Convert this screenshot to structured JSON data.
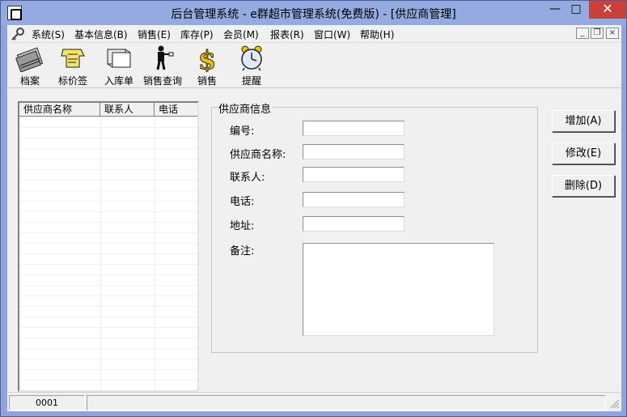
{
  "window": {
    "title": "后台管理系统 - e群超市管理系统(免费版) - [供应商管理]",
    "minimize_glyph": "—",
    "maximize_glyph": "□",
    "close_glyph": "✕",
    "mdi_minimize": "_",
    "mdi_restore": "❐",
    "mdi_close": "×"
  },
  "menu": {
    "items": [
      {
        "label": "系统(S)"
      },
      {
        "label": "基本信息(B)"
      },
      {
        "label": "销售(E)"
      },
      {
        "label": "库存(P)"
      },
      {
        "label": "会员(M)"
      },
      {
        "label": "报表(R)"
      },
      {
        "label": "窗口(W)"
      },
      {
        "label": "帮助(H)"
      }
    ]
  },
  "toolbar": {
    "items": [
      {
        "label": "档案",
        "icon": "archive-icon"
      },
      {
        "label": "标价签",
        "icon": "price-tag-icon"
      },
      {
        "label": "入库单",
        "icon": "stock-in-icon"
      },
      {
        "label": "销售查询",
        "icon": "sales-query-icon"
      },
      {
        "label": "销售",
        "icon": "dollar-icon"
      },
      {
        "label": "提醒",
        "icon": "alarm-clock-icon"
      }
    ]
  },
  "supplier_list": {
    "columns": [
      "供应商名称",
      "联系人",
      "电话"
    ],
    "rows": []
  },
  "form": {
    "legend": "供应商信息",
    "fields": [
      {
        "label": "编号:",
        "value": ""
      },
      {
        "label": "供应商名称:",
        "value": ""
      },
      {
        "label": "联系人:",
        "value": ""
      },
      {
        "label": "电话:",
        "value": ""
      },
      {
        "label": "地址:",
        "value": ""
      }
    ],
    "notes": {
      "label": "备注:",
      "value": ""
    }
  },
  "actions": {
    "add": "增加(A)",
    "edit": "修改(E)",
    "delete": "删除(D)"
  },
  "status": {
    "pane1": "0001",
    "pane2": ""
  },
  "colors": {
    "title_bar": "#94aae0",
    "close_button": "#c9403a",
    "dollar": "#f2c200"
  }
}
